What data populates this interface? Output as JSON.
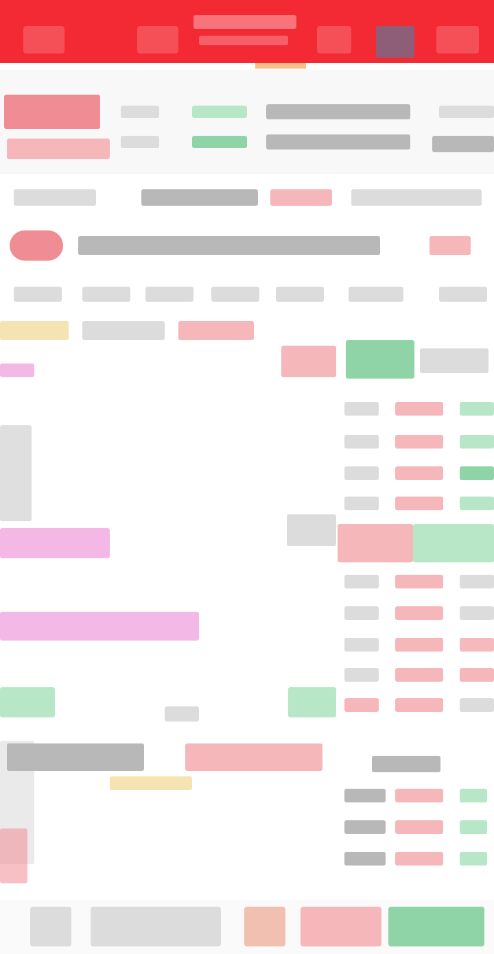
{
  "colors": {
    "header_bg": "#f32a34",
    "up": "#f08c93",
    "down": "#8fd4a7",
    "accent": "#f59d49",
    "highlight": "#f4b8e7"
  },
  "header": {
    "back_icon": "back-icon",
    "more_icon": "menu-icon",
    "search_icon": "search-icon"
  },
  "bottom_bar": {
    "buy_icon": "buy-icon",
    "sell_icon": "sell-icon"
  }
}
